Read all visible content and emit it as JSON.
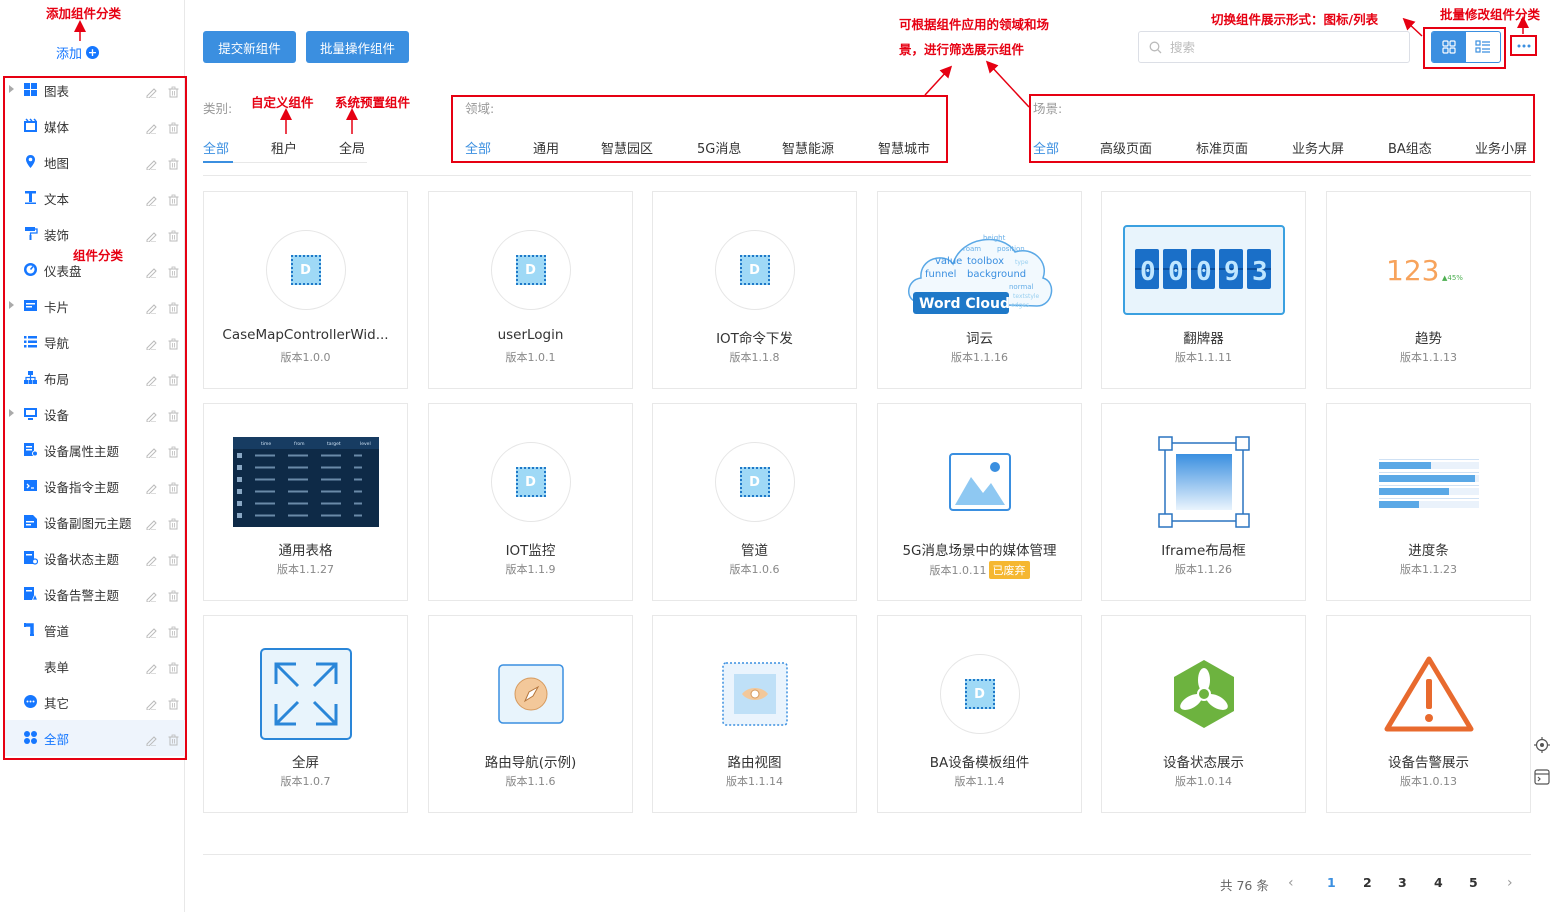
{
  "sidebar": {
    "add_label": "添加",
    "categories": [
      {
        "label": "图表",
        "icon": "chart-grid-icon",
        "expandable": true
      },
      {
        "label": "媒体",
        "icon": "media-icon",
        "expandable": false
      },
      {
        "label": "地图",
        "icon": "map-pin-icon",
        "expandable": false
      },
      {
        "label": "文本",
        "icon": "text-icon",
        "expandable": false
      },
      {
        "label": "装饰",
        "icon": "paint-roller-icon",
        "expandable": false
      },
      {
        "label": "仪表盘",
        "icon": "dashboard-icon",
        "expandable": false
      },
      {
        "label": "卡片",
        "icon": "card-icon",
        "expandable": true
      },
      {
        "label": "导航",
        "icon": "list-nav-icon",
        "expandable": false
      },
      {
        "label": "布局",
        "icon": "layout-tree-icon",
        "expandable": false
      },
      {
        "label": "设备",
        "icon": "device-icon",
        "expandable": true
      },
      {
        "label": "设备属性主题",
        "icon": "device-attr-icon",
        "expandable": false
      },
      {
        "label": "设备指令主题",
        "icon": "device-cmd-icon",
        "expandable": false
      },
      {
        "label": "设备副图元主题",
        "icon": "device-sub-icon",
        "expandable": false
      },
      {
        "label": "设备状态主题",
        "icon": "device-status-icon",
        "expandable": false
      },
      {
        "label": "设备告警主题",
        "icon": "device-alarm-icon",
        "expandable": false
      },
      {
        "label": "管道",
        "icon": "pipe-icon",
        "expandable": false
      },
      {
        "label": "表单",
        "icon": "",
        "expandable": false
      },
      {
        "label": "其它",
        "icon": "more-dots-icon",
        "expandable": false
      },
      {
        "label": "全部",
        "icon": "all-grid-icon",
        "expandable": false,
        "active": true
      }
    ]
  },
  "toolbar": {
    "submit_label": "提交新组件",
    "batch_label": "批量操作组件",
    "search_placeholder": "搜索"
  },
  "filters": {
    "category_label": "类别:",
    "category_tabs": [
      "全部",
      "租户",
      "全局"
    ],
    "domain_label": "领域:",
    "domain_tabs": [
      "全部",
      "通用",
      "智慧园区",
      "5G消息",
      "智慧能源",
      "智慧城市"
    ],
    "scene_label": "场景:",
    "scene_tabs": [
      "全部",
      "高级页面",
      "标准页面",
      "业务大屏",
      "BA组态",
      "业务小屏"
    ]
  },
  "cards": [
    {
      "name": "CaseMapControllerWid...",
      "version": "版本1.0.0",
      "thumb": "d-placeholder"
    },
    {
      "name": "userLogin",
      "version": "版本1.0.1",
      "thumb": "d-placeholder"
    },
    {
      "name": "IOT命令下发",
      "version": "版本1.1.8",
      "thumb": "d-placeholder"
    },
    {
      "name": "词云",
      "version": "版本1.1.16",
      "thumb": "word-cloud"
    },
    {
      "name": "翻牌器",
      "version": "版本1.1.11",
      "thumb": "flip-counter"
    },
    {
      "name": "趋势",
      "version": "版本1.1.13",
      "thumb": "trend"
    },
    {
      "name": "通用表格",
      "version": "版本1.1.27",
      "thumb": "table"
    },
    {
      "name": "IOT监控",
      "version": "版本1.1.9",
      "thumb": "d-placeholder"
    },
    {
      "name": "管道",
      "version": "版本1.0.6",
      "thumb": "d-placeholder"
    },
    {
      "name": "5G消息场景中的媒体管理",
      "version": "版本1.0.11",
      "badge": "已废弃",
      "thumb": "image"
    },
    {
      "name": "Iframe布局框",
      "version": "版本1.1.26",
      "thumb": "iframe"
    },
    {
      "name": "进度条",
      "version": "版本1.1.23",
      "thumb": "progress"
    },
    {
      "name": "全屏",
      "version": "版本1.0.7",
      "thumb": "fullscreen"
    },
    {
      "name": "路由导航(示例)",
      "version": "版本1.1.6",
      "thumb": "compass"
    },
    {
      "name": "路由视图",
      "version": "版本1.1.14",
      "thumb": "eye"
    },
    {
      "name": "BA设备模板组件",
      "version": "版本1.1.4",
      "thumb": "d-placeholder"
    },
    {
      "name": "设备状态展示",
      "version": "版本1.0.14",
      "thumb": "fan"
    },
    {
      "name": "设备告警展示",
      "version": "版本1.0.13",
      "thumb": "warning"
    }
  ],
  "thumb_text": {
    "word_cloud": {
      "title": "Word Cloud",
      "words": [
        "height",
        "roam",
        "position",
        "value",
        "toolbox",
        "type",
        "funnel",
        "background",
        "normal",
        "textstyle",
        "edges"
      ]
    },
    "flip_counter": "00093",
    "trend": {
      "value": "123",
      "delta": "▲45%"
    },
    "table_headers": [
      "time",
      "from",
      "target",
      "level"
    ]
  },
  "pagination": {
    "total": "共 76 条",
    "pages": [
      "1",
      "2",
      "3",
      "4",
      "5"
    ],
    "current": "1",
    "prev": "‹",
    "next": "›"
  },
  "annotations": {
    "add_category": "添加组件分类",
    "category": "组件分类",
    "custom": "自定义组件",
    "preset": "系统预置组件",
    "filter_line1": "可根据组件应用的领域和场",
    "filter_line2": "景，进行筛选展示组件",
    "toggle_view": "切换组件展示形式：图标/列表",
    "batch_edit": "批量修改组件分类",
    "color": "#e60012"
  },
  "colors": {
    "primary": "#3b8fe0",
    "deprecated": "#f5b731"
  }
}
